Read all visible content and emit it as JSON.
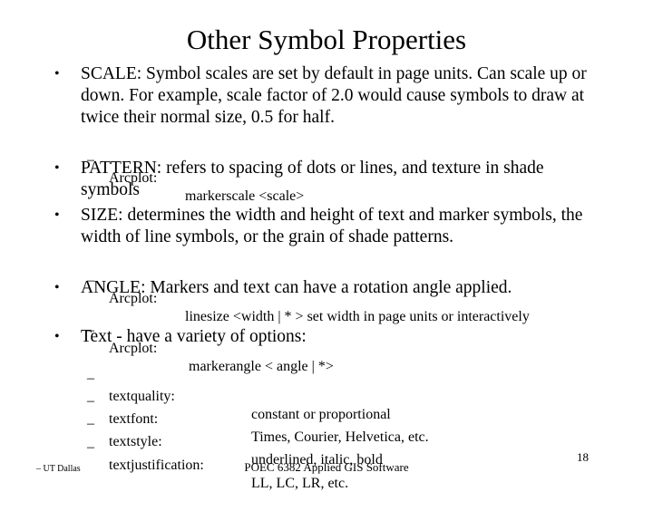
{
  "slide": {
    "title": "Other Symbol Properties",
    "bullets": [
      {
        "text": "SCALE:  Symbol scales are set by default in page units.  Can scale up or down.  For example, scale factor of 2.0 would cause symbols to draw at twice their normal size, 0.5 for half."
      },
      {
        "text": "PATTERN:  refers to spacing of dots or lines, and texture in shade symbols"
      },
      {
        "text": "SIZE:  determines the width and height of text and marker symbols, the width of line symbols, or the grain of shade patterns."
      },
      {
        "text": "ANGLE:  Markers and text can have a rotation angle applied."
      },
      {
        "text": "Text - have a variety of options:"
      }
    ],
    "subitems": {
      "scale": {
        "label": "Arcplot:",
        "value": "markerscale <scale>"
      },
      "size": {
        "label": "Arcplot:",
        "value": "linesize <width | * >   set width in page units or interactively"
      },
      "angle": {
        "label": "Arcplot:",
        "value": "markerangle   < angle | *>"
      },
      "text_options": [
        {
          "label": "textquality:",
          "value": "constant  or proportional"
        },
        {
          "label": "textfont:",
          "value": "Times, Courier, Helvetica, etc."
        },
        {
          "label": "textstyle:",
          "value": "underlined, italic, bold"
        },
        {
          "label": "textjustification:",
          "value": "LL, LC, LR, etc."
        }
      ]
    },
    "bullet_glyph": "•",
    "dash_glyph": "–"
  },
  "footer": {
    "left": "– UT Dallas",
    "center": "POEC 6382 Applied GIS Software",
    "page_number": "18"
  }
}
